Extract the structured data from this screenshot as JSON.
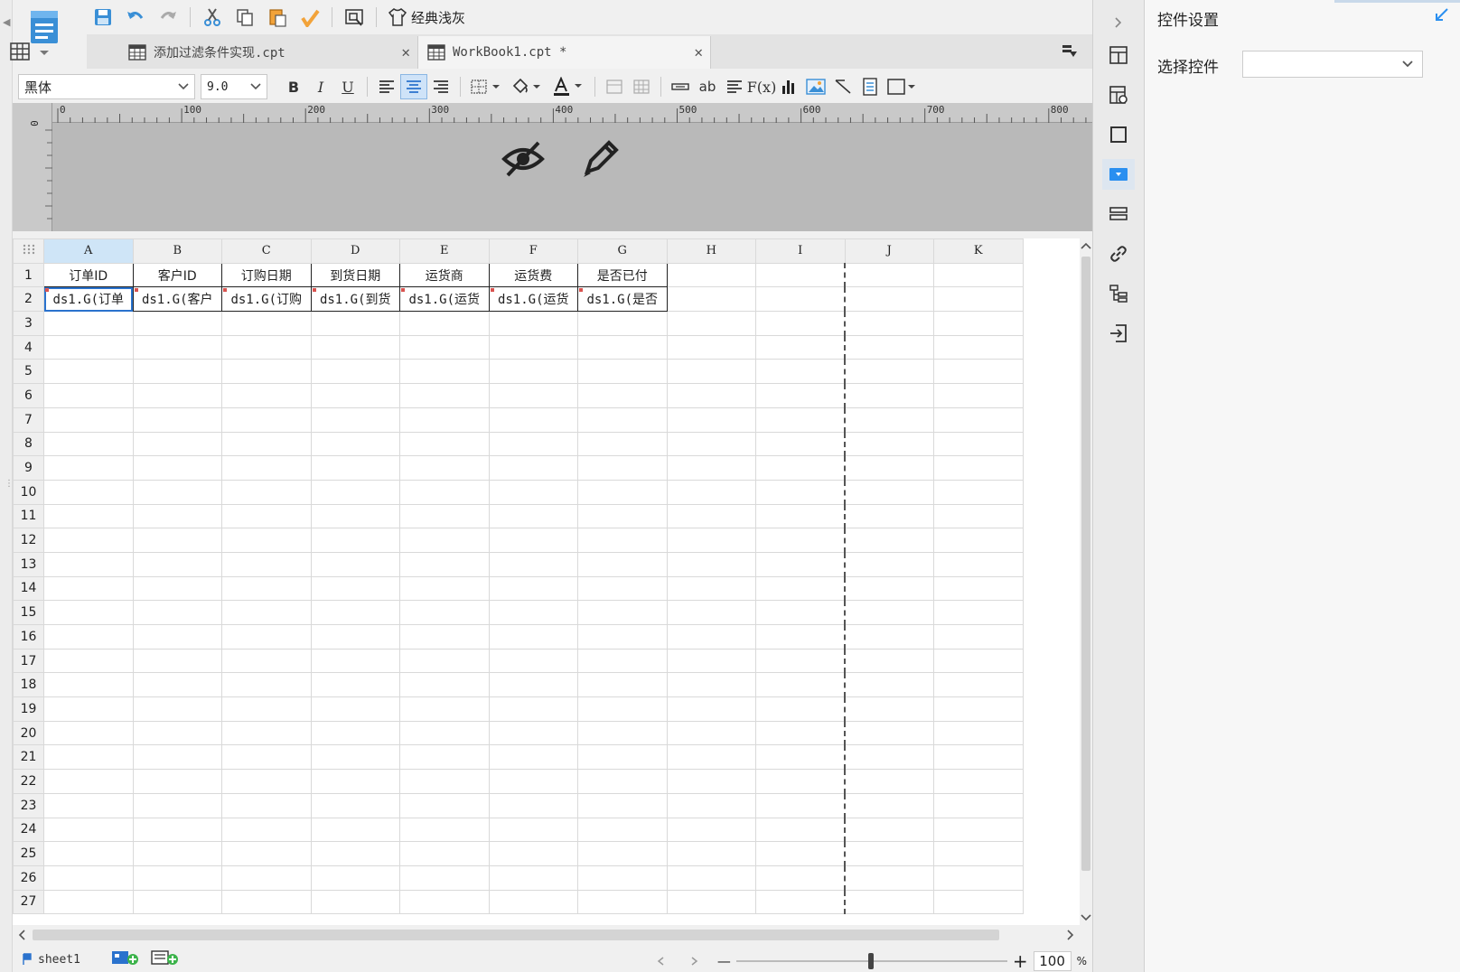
{
  "toolbar": {
    "theme_label": "经典浅灰"
  },
  "tabs": [
    {
      "label": "添加过滤条件实现.cpt",
      "active": false
    },
    {
      "label": "WorkBook1.cpt *",
      "active": true
    }
  ],
  "format_bar": {
    "font_name": "黑体",
    "font_size": "9.0"
  },
  "ruler": {
    "marks": [
      "0",
      "100",
      "200",
      "300",
      "400",
      "500",
      "600",
      "700",
      "800"
    ],
    "vertical_mark": "0"
  },
  "grid": {
    "columns": [
      "A",
      "B",
      "C",
      "D",
      "E",
      "F",
      "G",
      "H",
      "I",
      "J",
      "K"
    ],
    "rows": [
      "1",
      "2",
      "3",
      "4",
      "5",
      "6",
      "7",
      "8",
      "9",
      "10",
      "11",
      "12",
      "13",
      "14",
      "15",
      "16",
      "17",
      "18",
      "19",
      "20",
      "21",
      "22",
      "23",
      "24",
      "25",
      "26",
      "27"
    ],
    "header_row": [
      "订单ID",
      "客户ID",
      "订购日期",
      "到货日期",
      "运货商",
      "运货费",
      "是否已付"
    ],
    "data_row": [
      "ds1.G(订单",
      "ds1.G(客户",
      "ds1.G(订购",
      "ds1.G(到货",
      "ds1.G(运货",
      "ds1.G(运货",
      "ds1.G(是否"
    ]
  },
  "status": {
    "sheet_name": "sheet1",
    "zoom_value": "100",
    "zoom_unit": "%",
    "zoom_minus": "—",
    "zoom_plus": "+"
  },
  "panel": {
    "title": "控件设置",
    "select_label": "选择控件",
    "select_value": ""
  },
  "colors": {
    "accent": "#2a72cd",
    "selected_column": "#cfe5f7",
    "paper_bg": "#b9b9b9"
  }
}
